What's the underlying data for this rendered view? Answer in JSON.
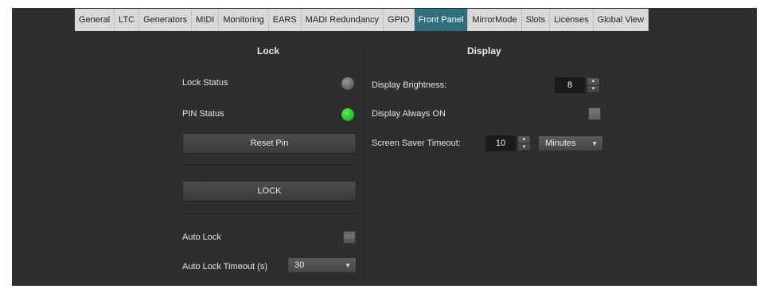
{
  "tabs": [
    {
      "label": "General",
      "active": false
    },
    {
      "label": "LTC",
      "active": false
    },
    {
      "label": "Generators",
      "active": false
    },
    {
      "label": "MIDI",
      "active": false
    },
    {
      "label": "Monitoring",
      "active": false
    },
    {
      "label": "EARS",
      "active": false
    },
    {
      "label": "MADI Redundancy",
      "active": false
    },
    {
      "label": "GPIO",
      "active": false
    },
    {
      "label": "Front Panel",
      "active": true
    },
    {
      "label": "MirrorMode",
      "active": false
    },
    {
      "label": "Slots",
      "active": false
    },
    {
      "label": "Licenses",
      "active": false
    },
    {
      "label": "Global View",
      "active": false
    }
  ],
  "colors": {
    "active_tab": "#2f6f7d",
    "panel_bg": "#2e2e2e",
    "led_on": "#1fbf1f",
    "led_off": "#6a6a6a"
  },
  "lock": {
    "title": "Lock",
    "lock_status_label": "Lock Status",
    "lock_status_led": "off",
    "pin_status_label": "PIN Status",
    "pin_status_led": "on",
    "reset_pin_label": "Reset Pin",
    "lock_button_label": "LOCK",
    "auto_lock_label": "Auto Lock",
    "auto_lock_toggle_text": "OFF",
    "auto_lock_timeout_label": "Auto Lock Timeout (s)",
    "auto_lock_timeout_value": "30"
  },
  "display": {
    "title": "Display",
    "brightness_label": "Display Brightness:",
    "brightness_value": "8",
    "always_on_label": "Display Always ON",
    "screensaver_label": "Screen Saver Timeout:",
    "screensaver_value": "10",
    "screensaver_unit": "Minutes"
  },
  "icons": {
    "spin_up": "▲",
    "spin_down": "▼",
    "dropdown_caret": "▼"
  }
}
